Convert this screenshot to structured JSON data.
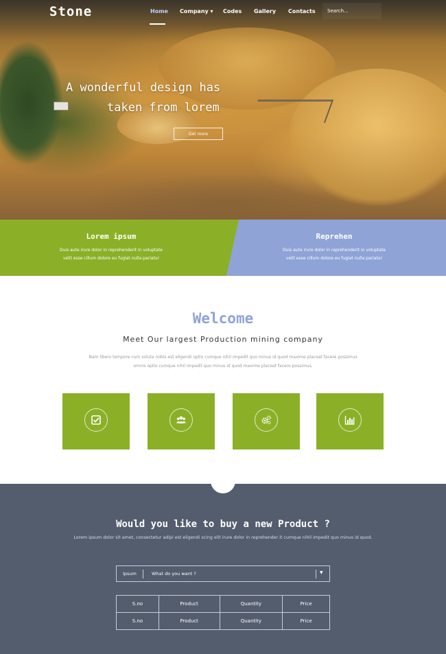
{
  "nav": {
    "brand": "Stone",
    "items": [
      {
        "label": "Home",
        "active": true
      },
      {
        "label": "Company ▾"
      },
      {
        "label": "Codes"
      },
      {
        "label": "Gallery"
      },
      {
        "label": "Contacts"
      }
    ],
    "search_placeholder": "Search..."
  },
  "hero": {
    "title_line1": "A wonderful design has",
    "title_line2": "taken from lorem",
    "button_label": "Get more"
  },
  "bands": [
    {
      "title": "Lorem ipsum",
      "text_line1": "Duis aute irure dolor in reprehenderit in voluptate",
      "text_line2": "velit esse cillum dolore eu fugiat nulla pariatur",
      "color": "#8bb028"
    },
    {
      "title": "Reprehen",
      "text_line1": "Duis aute irure dolor in reprehenderit in voluptate",
      "text_line2": "velit esse cillum dolore eu fugiat nulla pariatur",
      "color": "#8fa3d6"
    }
  ],
  "welcome": {
    "title": "Welcome",
    "subtitle": "Meet Our largest Production mining company",
    "text_line1": "Nam libero tempore cum soluta nobis est eligendi optio cumque nihil impedit quo minus id quod maxime placeat facere possimus",
    "text_line2": "omnis optio cumque nihil impedit quo minus id quod maxime placeat facere possimus."
  },
  "tiles": [
    {
      "icon": "checkbox-icon"
    },
    {
      "icon": "users-icon"
    },
    {
      "icon": "gears-icon"
    },
    {
      "icon": "bar-chart-icon"
    }
  ],
  "buy": {
    "title": "Would you like to buy a new Product ?",
    "text": "Lorem ipsum dolor sit amet, consectetur adipi est eligendi scing elit irure dolor in reprehender it cumque nihil impedit quo minus id quod.",
    "select_label": "Ipsum",
    "select_value": "What do you want ?",
    "table": {
      "rows": [
        [
          "S.no",
          "Product",
          "Quantity",
          "Price"
        ],
        [
          "S.no",
          "Product",
          "Quantity",
          "Price"
        ]
      ]
    }
  },
  "colors": {
    "accent_green": "#8bb028",
    "accent_blue": "#8fa3d6",
    "dark_section": "#535d6d"
  }
}
